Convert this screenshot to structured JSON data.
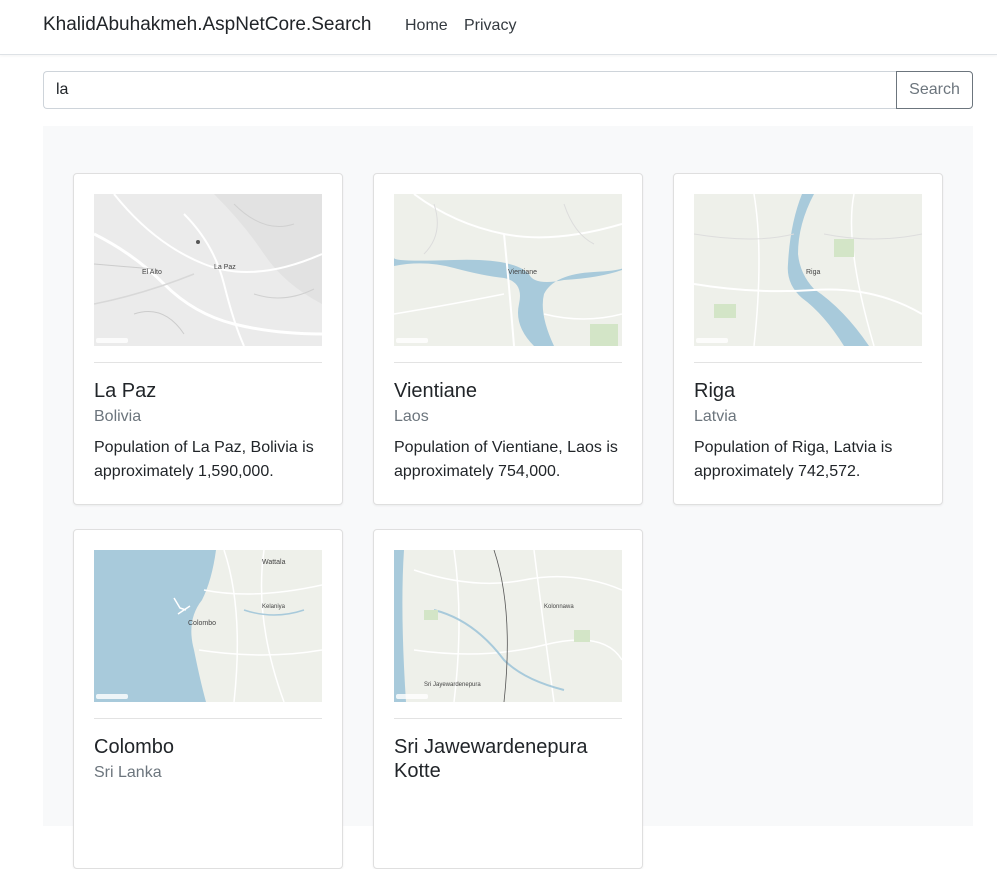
{
  "navbar": {
    "brand": "KhalidAbuhakmeh.AspNetCore.Search",
    "links": {
      "home": "Home",
      "privacy": "Privacy"
    }
  },
  "search": {
    "value": "la",
    "button_label": "Search"
  },
  "results": [
    {
      "city": "La Paz",
      "country": "Bolivia",
      "description": "Population of La Paz, Bolivia is approximately 1,590,000.",
      "map_labels": [
        "El Alto",
        "La Paz"
      ]
    },
    {
      "city": "Vientiane",
      "country": "Laos",
      "description": "Population of Vientiane, Laos is approximately 754,000.",
      "map_labels": [
        "Vientiane"
      ]
    },
    {
      "city": "Riga",
      "country": "Latvia",
      "description": "Population of Riga, Latvia is approximately 742,572.",
      "map_labels": [
        "Riga"
      ]
    },
    {
      "city": "Colombo",
      "country": "Sri Lanka",
      "description": "",
      "map_labels": [
        "Wattala",
        "Colombo",
        "Kelaniya"
      ]
    },
    {
      "city": "Sri Jawewardenepura Kotte",
      "country": "",
      "description": "",
      "map_labels": [
        "Kolonnawa",
        "Sri Jayewardenepura"
      ]
    }
  ],
  "colors": {
    "map_land": "#ececec",
    "map_water": "#a8cadb",
    "map_road": "#ffffff",
    "map_green": "#d3e5c7",
    "muted_text": "#6c757d"
  }
}
